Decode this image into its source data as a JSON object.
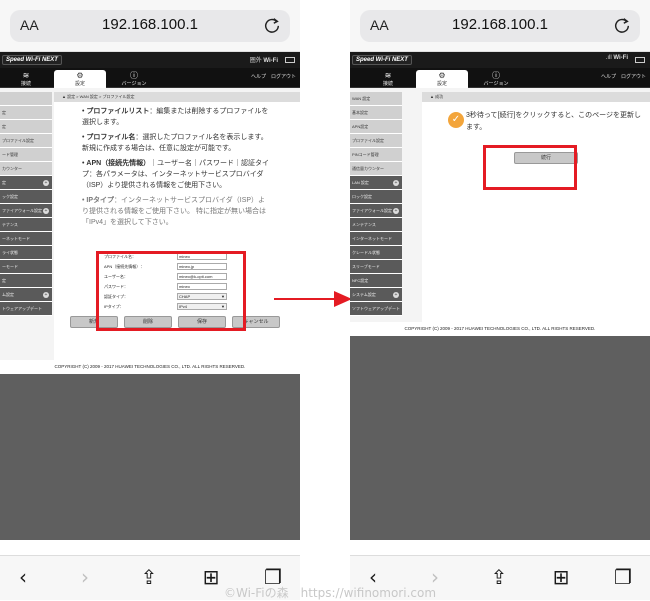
{
  "browser": {
    "aa_label": "AA",
    "url": "192.168.100.1"
  },
  "router": {
    "logo": "Speed Wi-Fi NEXT",
    "signal_left": "圏外",
    "signal_right": ".ıll",
    "wifi_label": "Wi-Fi",
    "tabs": [
      {
        "label": "接続",
        "icon": "wifi-icon"
      },
      {
        "label": "設定",
        "icon": "gear-icon"
      },
      {
        "label": "バージョン",
        "icon": "info-icon"
      }
    ],
    "help": "ヘルプ",
    "logout": "ログアウト",
    "copyright": "COPYRIGHT (C) 2009 - 2017 HUAWEI TECHNOLOGIES CO., LTD. ALL RIGHTS RESERVED."
  },
  "left": {
    "sidebar": [
      {
        "label": "",
        "style": "light"
      },
      {
        "label": "定",
        "style": "light"
      },
      {
        "label": "定",
        "style": "light"
      },
      {
        "label": "プロファイル設定",
        "style": "light"
      },
      {
        "label": "ード管理",
        "style": "light"
      },
      {
        "label": "カウンター",
        "style": "light"
      },
      {
        "label": "定",
        "style": "dark",
        "plus": "+"
      },
      {
        "label": "ック設定",
        "style": "dark"
      },
      {
        "label": "ファイアウォール設定",
        "style": "dark",
        "plus": "+"
      },
      {
        "label": "テナンス",
        "style": "dark"
      },
      {
        "label": "ーネットモード",
        "style": "dark"
      },
      {
        "label": "ライ状態",
        "style": "dark"
      },
      {
        "label": "ーモード",
        "style": "dark"
      },
      {
        "label": "定",
        "style": "dark"
      },
      {
        "label": "ム設定",
        "style": "dark",
        "plus": "+"
      },
      {
        "label": "トウェアアップデート",
        "style": "dark"
      }
    ],
    "breadcrumb": "▲ 設定 > WAN 設定 > プロファイル設定",
    "desc": [
      {
        "title": "プロファイルリスト",
        "text": "：編集または削除するプロファイルを選択します。"
      },
      {
        "title": "プロファイル名",
        "text": "：選択したプロファイル名を表示します。新規に作成する場合は、任意に設定が可能です。"
      },
      {
        "title": "APN（接続先情報）",
        "text": "｜ユーザー名｜パスワード｜認証タイプ：各パラメータは、インターネットサービスプロバイダ（ISP）より提供される情報をご使用下さい。"
      },
      {
        "title": "IPタイプ",
        "text": "：インターネットサービスプロバイダ（ISP）より提供される情報をご使用下さい。 特に指定が無い場合は「IPv4」を選択して下さい。"
      }
    ],
    "form": [
      {
        "label": "プロファイル名：",
        "value": "mineo",
        "select": false
      },
      {
        "label": "APN（接続先情報）：",
        "value": "mineo.jp",
        "select": false
      },
      {
        "label": "ユーザー名：",
        "value": "mineo@k-opti.com",
        "select": false
      },
      {
        "label": "パスワード：",
        "value": "mineo",
        "select": false
      },
      {
        "label": "認証タイプ：",
        "value": "CHAP",
        "select": true
      },
      {
        "label": "IPタイプ：",
        "value": "IPv4",
        "select": true
      }
    ],
    "buttons": [
      "新規",
      "削除",
      "保存",
      "キャンセル"
    ]
  },
  "right": {
    "sidebar": [
      {
        "label": "WAN 設定",
        "style": "light"
      },
      {
        "label": "基本設定",
        "style": "light"
      },
      {
        "label": "APN設定",
        "style": "light"
      },
      {
        "label": "プロファイル設定",
        "style": "light"
      },
      {
        "label": "PINコード管理",
        "style": "light"
      },
      {
        "label": "通信量カウンター",
        "style": "light"
      },
      {
        "label": "LAN 設定",
        "style": "dark",
        "plus": "+"
      },
      {
        "label": "ロック設定",
        "style": "dark"
      },
      {
        "label": "ファイアウォール設定",
        "style": "dark",
        "plus": "+"
      },
      {
        "label": "メンテナンス",
        "style": "dark"
      },
      {
        "label": "インターネットモード",
        "style": "dark"
      },
      {
        "label": "クレードル状態",
        "style": "dark"
      },
      {
        "label": "スリープモード",
        "style": "dark"
      },
      {
        "label": "NFC設定",
        "style": "dark"
      },
      {
        "label": "システム設定",
        "style": "dark",
        "plus": "+"
      },
      {
        "label": "ソフトウェアアップデート",
        "style": "dark"
      }
    ],
    "breadcrumb": "▲ 成功",
    "message": "3秒待って[続行]をクリックすると、このページを更新します。",
    "ok_button": "続行"
  },
  "watermark": "©Wi-Fiの森　https://wifinomori.com",
  "colors": {
    "highlight": "#e41b23",
    "success": "#f3a53b"
  }
}
